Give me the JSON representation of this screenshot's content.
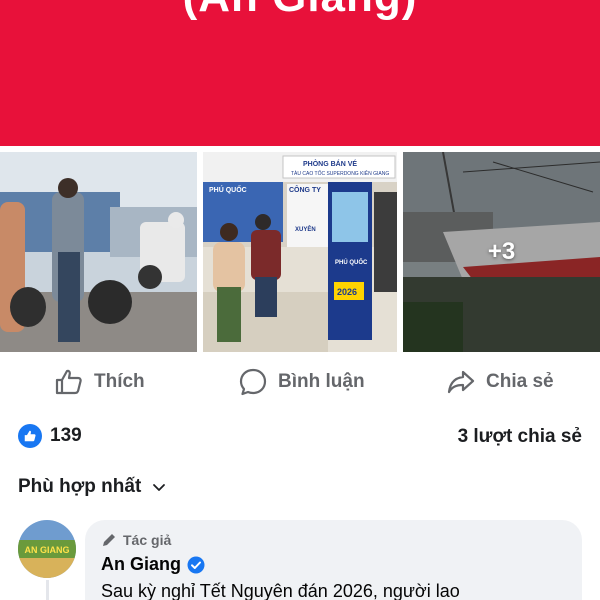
{
  "banner": {
    "text": "(An Giang)",
    "color": "#e8113a"
  },
  "photos": {
    "more_count": "+3",
    "items": [
      {
        "icon": "street-scene-photo"
      },
      {
        "icon": "ticket-office-photo",
        "signs": [
          "PHÒNG BÁN VÉ",
          "TÀU CAO TỐC SUPERDONG KIÊN GIANG",
          "PHÚ QUỐC",
          "CÔNG TY",
          "XUYÊN",
          "PHÚ QUỐC",
          "2026"
        ]
      },
      {
        "icon": "speedboat-dock-photo"
      }
    ]
  },
  "actions": {
    "like": {
      "label": "Thích",
      "icon": "thumbs-up-icon"
    },
    "comment": {
      "label": "Bình luận",
      "icon": "comment-bubble-icon"
    },
    "share": {
      "label": "Chia sẻ",
      "icon": "share-arrow-icon"
    }
  },
  "stats": {
    "like_count": "139",
    "share_count": "3 lượt chia sẻ"
  },
  "sort": {
    "label": "Phù hợp nhất"
  },
  "comment": {
    "tag": "Tác giả",
    "author": "An Giang",
    "avatar_text": "AN GIANG",
    "text": "Sau kỳ nghỉ Tết Nguyên đán 2026, người lao"
  },
  "colors": {
    "accent": "#1877f2",
    "muted_text": "#65676b",
    "bubble_bg": "#f0f2f5"
  }
}
